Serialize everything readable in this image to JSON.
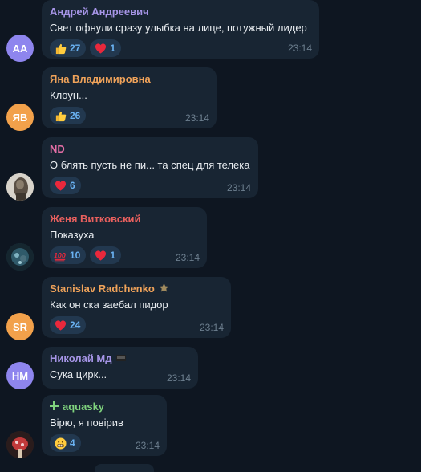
{
  "messages": [
    {
      "author": "Андрей Андреевич",
      "author_color": "#a695e7",
      "avatar_initials": "АА",
      "avatar_color": "#8e85ee",
      "text": "Свет офнули сразу улыбка на лице, потужный лидер",
      "time": "23:14",
      "reactions": [
        {
          "icon": "thumbs-up-icon",
          "count": "27"
        },
        {
          "icon": "heart-icon",
          "count": "1"
        }
      ]
    },
    {
      "author": "Яна Владимировна",
      "author_color": "#f0a35a",
      "avatar_initials": "ЯВ",
      "avatar_color": "#f2a14b",
      "text": "Клоун...",
      "time": "23:14",
      "reactions": [
        {
          "icon": "thumbs-up-icon",
          "count": "26"
        }
      ]
    },
    {
      "author": "ND",
      "author_color": "#e36ea5",
      "avatar_initials": "",
      "avatar_color": "#c9c4bb",
      "text": "О блять пусть не пи... та спец для телека",
      "time": "23:14",
      "reactions": [
        {
          "icon": "heart-icon",
          "count": "6"
        }
      ]
    },
    {
      "author": "Женя Витковский",
      "author_color": "#e8605e",
      "avatar_initials": "",
      "avatar_color": "#1f3a4a",
      "text": "Показуха",
      "time": "23:14",
      "reactions": [
        {
          "icon": "hundred-icon",
          "count": "10"
        },
        {
          "icon": "heart-icon",
          "count": "1"
        }
      ]
    },
    {
      "author": "Stanislav Radchenko",
      "author_color": "#f0a35a",
      "avatar_initials": "SR",
      "avatar_color": "#f2a14b",
      "text": "Как он ска заебал пидор",
      "time": "23:14",
      "reactions": [
        {
          "icon": "heart-icon",
          "count": "24"
        }
      ]
    },
    {
      "author": "Николай Мд",
      "author_color": "#a695e7",
      "avatar_initials": "НМ",
      "avatar_color": "#8e85ee",
      "text": "Сука цирк...",
      "time": "23:14",
      "reactions": []
    },
    {
      "author": "aquasky",
      "author_color": "#7fd27d",
      "avatar_initials": "",
      "avatar_color": "#3a2222",
      "text": "Вірю, я повірив",
      "time": "23:14",
      "reactions": [
        {
          "icon": "grimacing-face-icon",
          "count": "4"
        }
      ]
    }
  ]
}
